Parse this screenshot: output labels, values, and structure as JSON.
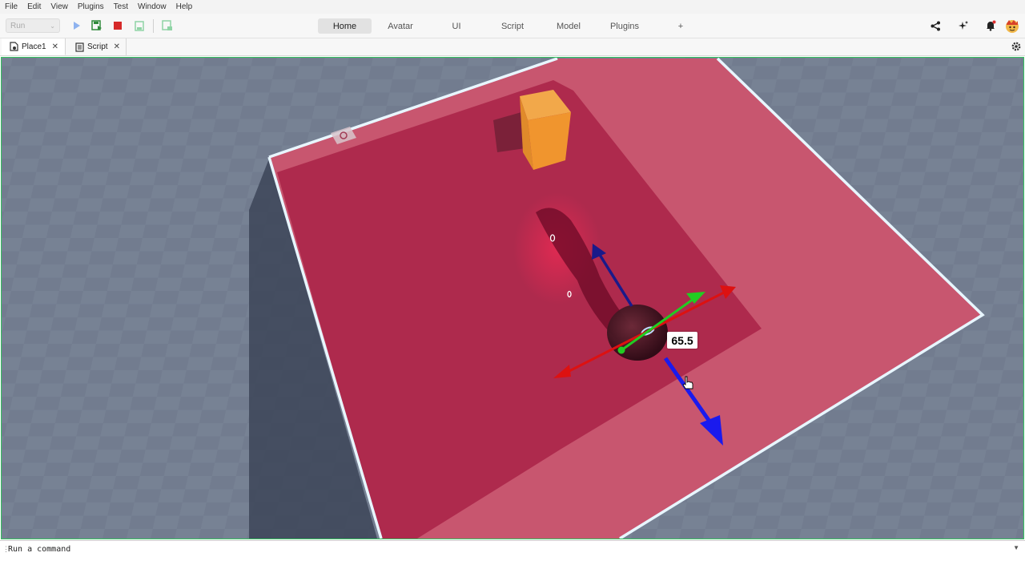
{
  "menu": [
    "File",
    "Edit",
    "View",
    "Plugins",
    "Test",
    "Window",
    "Help"
  ],
  "toolbar": {
    "run_label": "Run",
    "ribbon_tabs": [
      "Home",
      "Avatar",
      "UI",
      "Script",
      "Model",
      "Plugins"
    ],
    "add_tab_label": "+"
  },
  "doc_tabs": [
    {
      "label": "Place1",
      "close": "✕"
    },
    {
      "label": "Script",
      "close": "✕"
    }
  ],
  "viewport": {
    "dimension_label": "65.5"
  },
  "command_bar": {
    "placeholder": "Run a command"
  },
  "colors": {
    "accent_green": "#33c25e",
    "part_red": "#c8244a",
    "part_orange": "#f0932a",
    "axis_x": "#dd1111",
    "axis_y": "#22cc22",
    "axis_z": "#1a1aee",
    "baseplate": "#7f8a9c"
  },
  "icons": [
    "play-icon",
    "save-play-icon",
    "stop-icon",
    "save-icon",
    "save-as-icon",
    "share-icon",
    "sparkle-icon",
    "notification-bell-icon",
    "avatar-icon",
    "settings-gear-icon",
    "place-document-icon",
    "script-document-icon",
    "hand-cursor-icon"
  ]
}
